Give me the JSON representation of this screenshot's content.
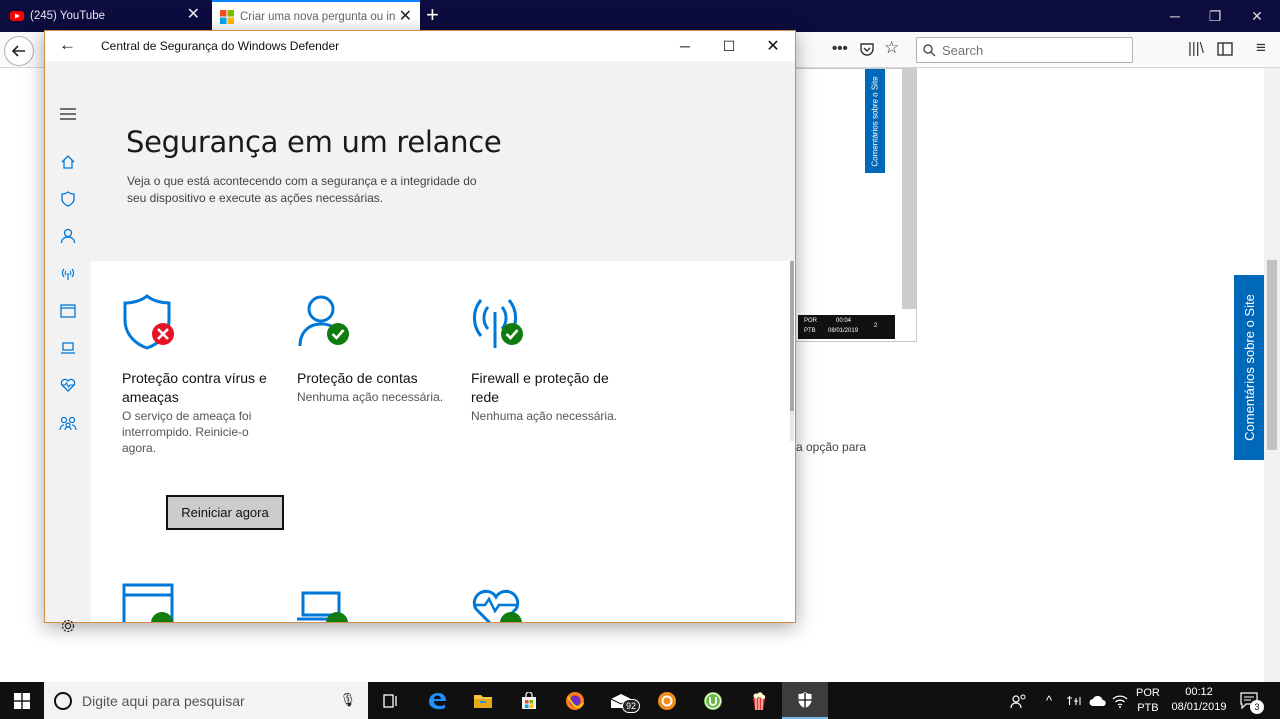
{
  "browser": {
    "tabs": [
      {
        "title": "(245) YouTube",
        "icon": "youtube-icon"
      },
      {
        "title": "Criar uma nova pergunta ou in",
        "icon": "windows-logo-icon"
      }
    ],
    "search_placeholder": "Search"
  },
  "background_page": {
    "feedback_tab": "Comentários sobre o Site",
    "feedback_tab_small": "Comentários sobre o Site",
    "partial_text": "a opção para",
    "mini_taskbar": {
      "lang1": "POR",
      "lang2": "PTB",
      "time": "00:04",
      "date": "08/01/2019",
      "badge": "2"
    }
  },
  "defender": {
    "window_title": "Central de Segurança do Windows Defender",
    "heading": "Segurança em um relance",
    "description": "Veja o que está acontecendo com a segurança e a integridade do seu dispositivo e execute as ações necessárias.",
    "cards": [
      {
        "title": "Proteção contra vírus e ameaças",
        "desc": "O serviço de ameaça foi interrompido. Reinicie-o agora.",
        "status": "error"
      },
      {
        "title": "Proteção de contas",
        "desc": "Nenhuma ação necessária.",
        "status": "ok"
      },
      {
        "title": "Firewall e proteção de rede",
        "desc": "Nenhuma ação necessária.",
        "status": "ok"
      }
    ],
    "restart_button": "Reiniciar agora",
    "colors": {
      "accent": "#0078d7",
      "ok": "#107c10",
      "error": "#e81123"
    }
  },
  "taskbar": {
    "search_placeholder": "Digite aqui para pesquisar",
    "mail_badge": "92",
    "lang_primary": "POR",
    "lang_secondary": "PTB",
    "time": "00:12",
    "date": "08/01/2019",
    "notifications": "3"
  }
}
